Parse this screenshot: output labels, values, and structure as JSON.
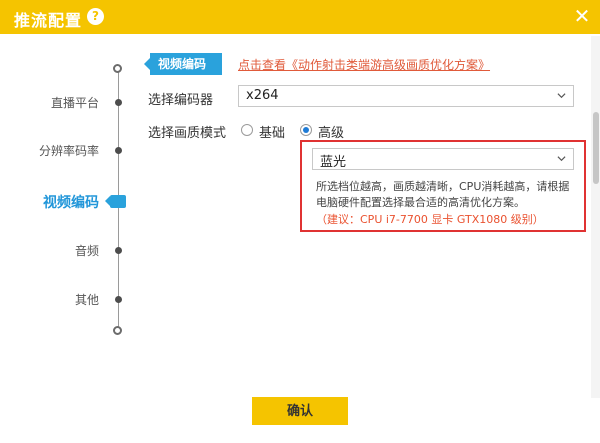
{
  "window": {
    "title": "推流配置",
    "help_glyph": "?",
    "close_glyph": "✕",
    "accent_color": "#f5c400"
  },
  "sidebar": {
    "items": [
      {
        "label": "直播平台"
      },
      {
        "label": "分辨率码率"
      },
      {
        "label": "视频编码",
        "active": true
      },
      {
        "label": "音频"
      },
      {
        "label": "其他"
      }
    ],
    "active_color": "#2196d9"
  },
  "section": {
    "title": "视频编码",
    "tip_link": "点击查看《动作射击类端游高级画质优化方案》"
  },
  "encoder": {
    "label": "选择编码器",
    "value": "x264"
  },
  "quality_mode": {
    "label": "选择画质模式",
    "options": [
      {
        "label": "基础",
        "selected": false
      },
      {
        "label": "高级",
        "selected": true
      }
    ]
  },
  "quality_level": {
    "value": "蓝光",
    "description": "所选档位越高，画质越清晰，CPU消耗越高，请根据电脑硬件配置选择最合适的高清优化方案。",
    "suggestion": "（建议：CPU  i7-7700 显卡 GTX1080 级别）"
  },
  "footer": {
    "confirm_label": "确认"
  }
}
